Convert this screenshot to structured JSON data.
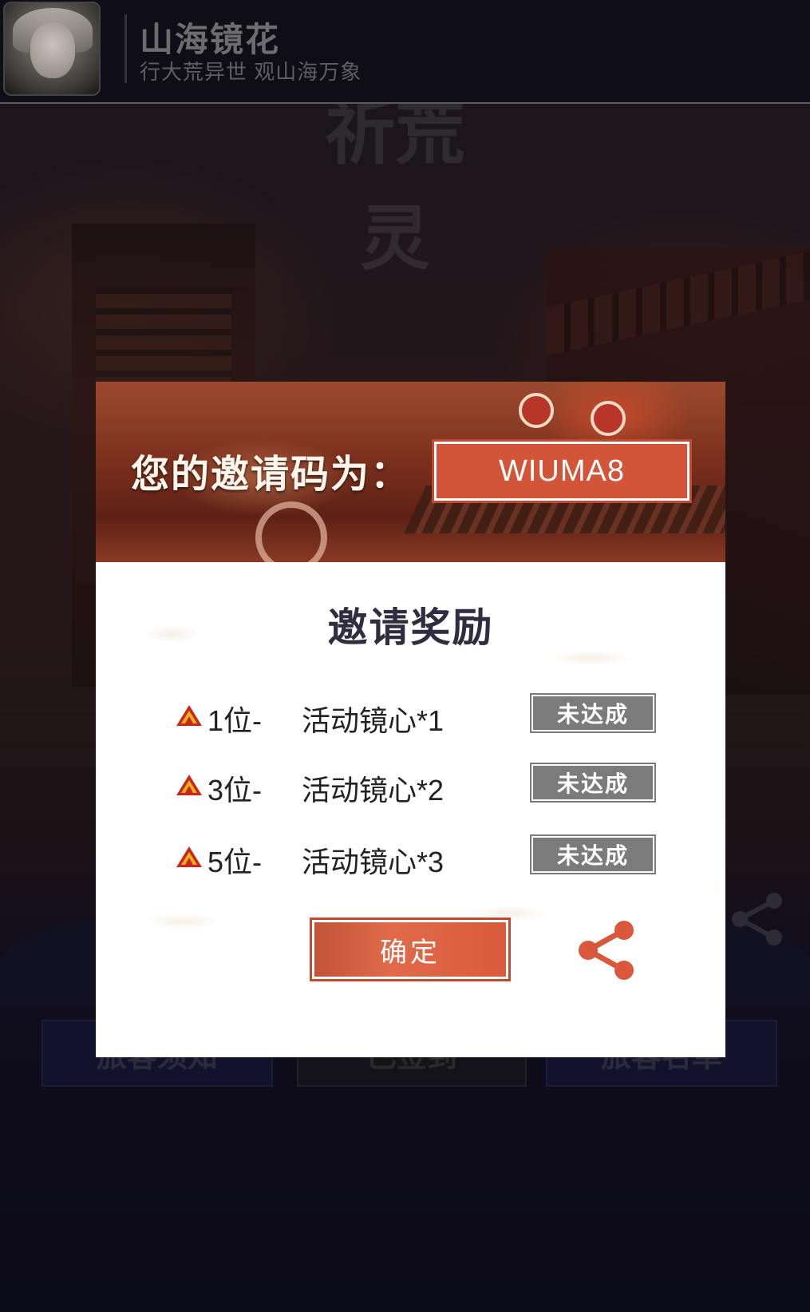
{
  "header": {
    "app_title": "山海镜花",
    "app_subtitle": "行大荒异世 观山海万象"
  },
  "background": {
    "title_line1": "祈荒",
    "title_line2": "灵",
    "buttons": [
      "旅客须知",
      "已签到",
      "旅客名单"
    ]
  },
  "modal": {
    "invite_label": "您的邀请码为：",
    "invite_code": "WIUMA8",
    "reward_title": "邀请奖励",
    "rewards": [
      {
        "rank": "1位-",
        "prize": "活动镜心*1",
        "status": "未达成"
      },
      {
        "rank": "3位-",
        "prize": "活动镜心*2",
        "status": "未达成"
      },
      {
        "rank": "5位-",
        "prize": "活动镜心*3",
        "status": "未达成"
      }
    ],
    "confirm_label": "确定",
    "share_icon": "share-icon"
  },
  "colors": {
    "accent": "#d2553a",
    "status_gray": "#7b7b7b",
    "topbar": "#0f0e16"
  }
}
